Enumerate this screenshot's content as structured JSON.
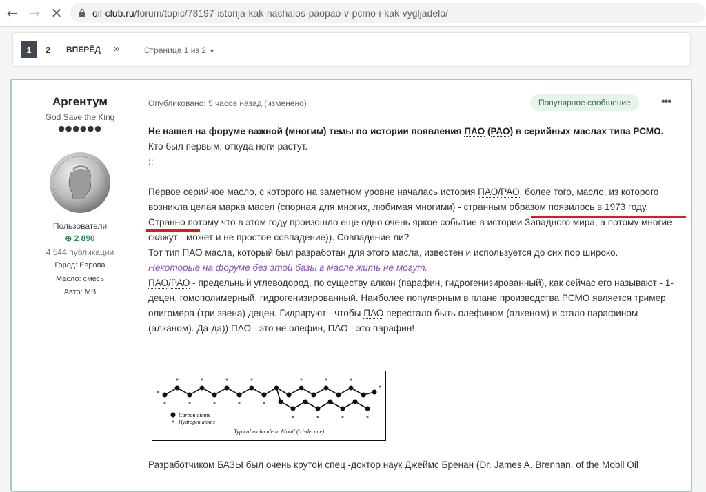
{
  "browser": {
    "back_icon": "arrow-left-icon",
    "forward_icon": "arrow-right-icon",
    "stop_icon": "close-icon",
    "url_domain": "oil-club.ru",
    "url_path": "/forum/topic/78197-istorija-kak-nachalos-paopao-v-pcmo-i-kak-vygljadelo/"
  },
  "pagination": {
    "current_page": "1",
    "page_2": "2",
    "next_label": "ВПЕРЁД",
    "last_label": "»",
    "page_info": "Страница 1 из 2"
  },
  "author": {
    "name": "Аргентум",
    "title": "God Save the King",
    "pips": "●●●●●●",
    "group": "Пользователи",
    "reputation": "2 890",
    "posts": "4 544 публикации",
    "city": "Город: Европа",
    "oil": "Масло: смесь",
    "car": "Авто: MB"
  },
  "post": {
    "meta": "Опубликовано: 5 часов назад (изменено)",
    "badge": "Популярное сообщение",
    "more_icon": "ellipsis-icon",
    "p1_a": "Не нашел на форуме важной (многим) темы по истории появления ",
    "p1_b": "ПАО",
    "p1_c": " (",
    "p1_d": "РАО",
    "p1_e": ") в серийных маслах типа РСМО.",
    "p2": "Кто был первым, откуда ноги растут.",
    "p3": "::",
    "p4_a": "Первое серийное масло, с которого на заметном уровне началась история ",
    "p4_b": "ПАО",
    "p4_c": "/",
    "p4_d": "РАО",
    "p4_e": ", более того, масло, из которого возникла целая марка масел (спорная для многих, любимая многими) - странным образом появилось в 1973 году.",
    "p5": "Странно потому что в этом году произошло еще одно очень яркое событие в истории Западного мира, а потому многие скажут - может и не простое совпадение)). Совпадение ли?",
    "p6_a": "Тот тип ",
    "p6_b": "ПАО",
    "p6_c": " масла, который был разработан для этого масла, известен и используется до сих пор широко.",
    "p7": "Некоторые на форуме без этой базы в масле жить не могут.",
    "p8_a": "ПАО",
    "p8_b": "/",
    "p8_c": "РАО",
    "p8_d": " - предельный углеводород, по существу алкан (парафин, гидрогенизированный), как сейчас его называют - 1-децен, гомополимерный, гидрогенизированный. Наиболее популярным в плане производства РСМО является тример олигомера (три звена) децен. Гидрируют - чтобы ",
    "p8_e": "ПАО",
    "p8_f": " перестало быть олефином (алкеном) и стало парафином (алканом). Да-да)) ",
    "p8_g": "ПАО",
    "p8_h": " - это не олефин, ",
    "p8_i": "ПАО",
    "p8_j": " - это парафин!",
    "p9": "Разработчиком БАЗЫ был очень крутой спец -доктор наук Джеймс Бренан (Dr. James A. Brennan, of the Mobil Oil"
  },
  "figure": {
    "legend_carbon": "Carbon atoms",
    "legend_hydrogen": "Hydrogen atoms",
    "caption": "Typical molecule in Mobil (tri-decene)"
  },
  "colors": {
    "accent_border": "#9fd1ba",
    "highlight_red": "#e01b1b",
    "badge_bg": "#e6f4ea",
    "purple_text": "#8a4fbf"
  }
}
